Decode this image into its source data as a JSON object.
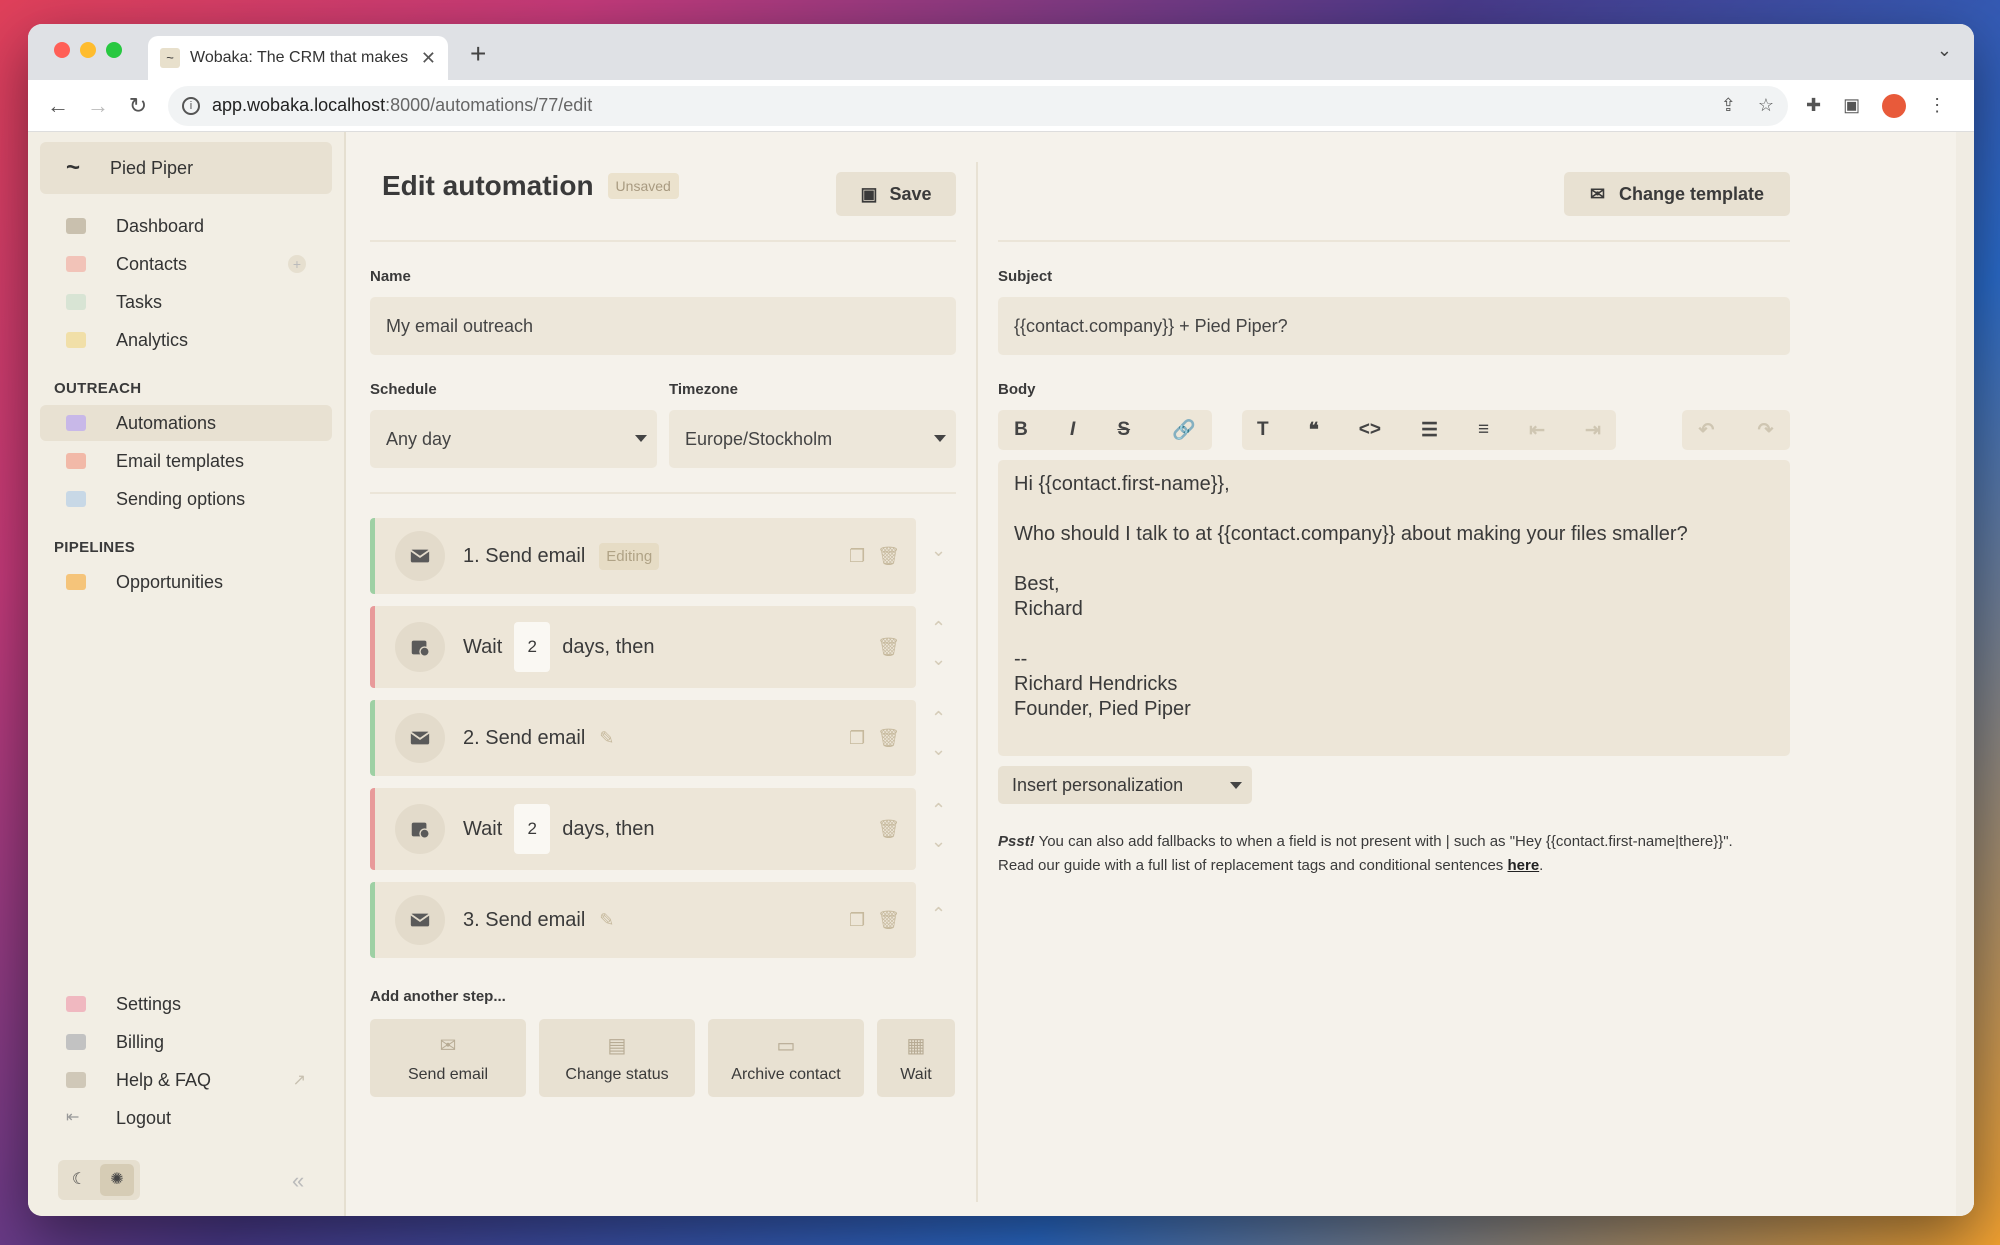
{
  "browser": {
    "tab_title": "Wobaka: The CRM that makes",
    "url_host": "app.wobaka.localhost",
    "url_path": ":8000/automations/77/edit"
  },
  "sidebar": {
    "org_name": "Pied Piper",
    "main_items": [
      {
        "label": "Dashboard"
      },
      {
        "label": "Contacts"
      },
      {
        "label": "Tasks"
      },
      {
        "label": "Analytics"
      }
    ],
    "outreach_title": "OUTREACH",
    "outreach_items": [
      {
        "label": "Automations"
      },
      {
        "label": "Email templates"
      },
      {
        "label": "Sending options"
      }
    ],
    "pipelines_title": "PIPELINES",
    "pipelines_items": [
      {
        "label": "Opportunities"
      }
    ],
    "bottom_items": [
      {
        "label": "Settings"
      },
      {
        "label": "Billing"
      },
      {
        "label": "Help & FAQ"
      },
      {
        "label": "Logout"
      }
    ]
  },
  "editor": {
    "title": "Edit automation",
    "status_badge": "Unsaved",
    "save_label": "Save",
    "name_label": "Name",
    "name_value": "My email outreach",
    "schedule_label": "Schedule",
    "schedule_value": "Any day",
    "timezone_label": "Timezone",
    "timezone_value": "Europe/Stockholm",
    "steps": [
      {
        "label": "1. Send email",
        "badge": "Editing"
      },
      {
        "prefix": "Wait",
        "days": "2",
        "suffix": "days, then"
      },
      {
        "label": "2. Send email"
      },
      {
        "prefix": "Wait",
        "days": "2",
        "suffix": "days, then"
      },
      {
        "label": "3. Send email"
      }
    ],
    "add_step_title": "Add another step...",
    "add_step_buttons": [
      {
        "label": "Send email"
      },
      {
        "label": "Change status"
      },
      {
        "label": "Archive contact"
      },
      {
        "label": "Wait"
      }
    ]
  },
  "email": {
    "change_template_label": "Change template",
    "subject_label": "Subject",
    "subject_value": "{{contact.company}} + Pied Piper?",
    "body_label": "Body",
    "body_text": "Hi {{contact.first-name}},\n\nWho should I talk to at {{contact.company}} about making your files smaller?\n\nBest,\nRichard\n\n--\nRichard Hendricks\nFounder, Pied Piper",
    "insert_personalization": "Insert personalization",
    "note_psst": "Psst!",
    "note_line1": " You can also add fallbacks to when a field is not present with | such as \"Hey {{contact.first-name|there}}\".",
    "note_line2": "Read our guide with a full list of replacement tags and conditional sentences ",
    "note_link": "here",
    "note_end": "."
  },
  "colors": {
    "accent_green": "#9ed0a4",
    "accent_red": "#e89a9a",
    "panel": "#ede6d8"
  }
}
